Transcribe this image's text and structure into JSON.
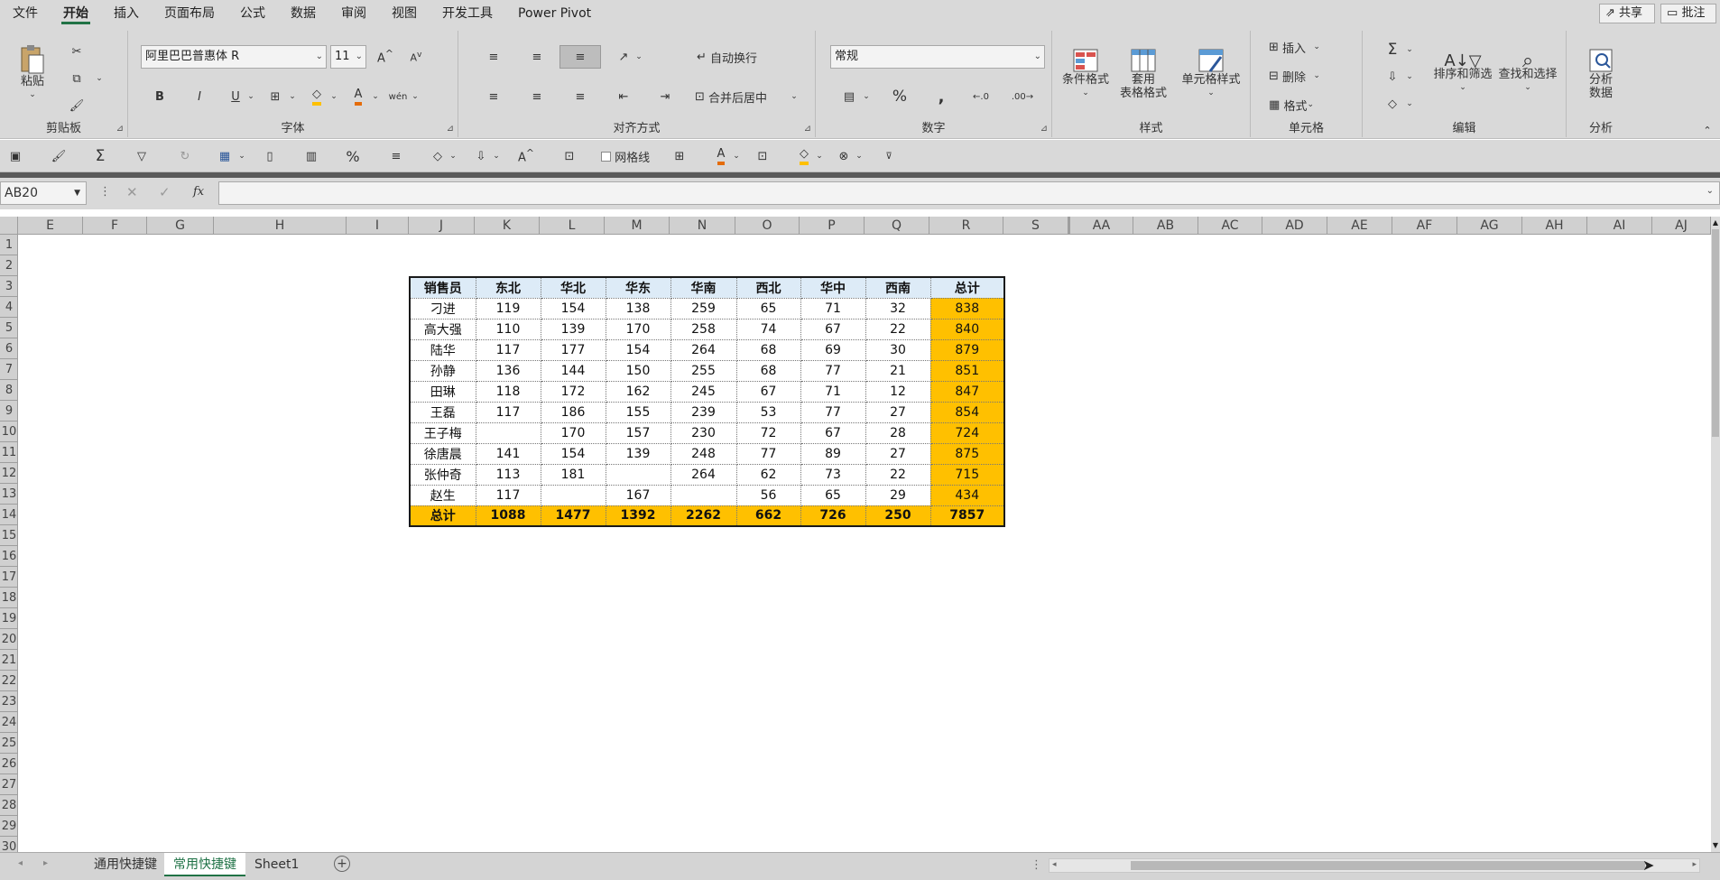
{
  "menu": {
    "items": [
      "文件",
      "开始",
      "插入",
      "页面布局",
      "公式",
      "数据",
      "审阅",
      "视图",
      "开发工具",
      "Power Pivot"
    ],
    "share": "共享",
    "comments": "批注"
  },
  "ribbon": {
    "clipboard": {
      "label": "剪贴板",
      "paste": "粘贴"
    },
    "font": {
      "label": "字体",
      "font_name": "阿里巴巴普惠体 R",
      "font_size": "11",
      "bold": "B",
      "italic": "I",
      "underline": "U"
    },
    "alignment": {
      "label": "对齐方式",
      "wrap": "自动换行",
      "merge": "合并后居中"
    },
    "number": {
      "label": "数字",
      "format": "常规"
    },
    "styles": {
      "label": "样式",
      "conditional": "条件格式",
      "table_format_1": "套用",
      "table_format_2": "表格格式",
      "cell_styles": "单元格样式"
    },
    "cells": {
      "label": "单元格",
      "insert": "插入",
      "delete": "删除",
      "format": "格式"
    },
    "editing": {
      "label": "编辑",
      "sort_filter": "排序和筛选",
      "find_select": "查找和选择"
    },
    "analysis": {
      "label": "分析",
      "analyze_1": "分析",
      "analyze_2": "数据"
    }
  },
  "qat": {
    "gridlines": "网格线"
  },
  "formula_bar": {
    "name_box": "AB20",
    "fx": "fx",
    "value": ""
  },
  "columns": [
    "E",
    "F",
    "G",
    "H",
    "I",
    "J",
    "K",
    "L",
    "M",
    "N",
    "O",
    "P",
    "Q",
    "R",
    "S",
    "AA",
    "AB",
    "AC",
    "AD",
    "AE",
    "AF",
    "AG",
    "AH",
    "AI",
    "AJ"
  ],
  "rows": [
    "1",
    "2",
    "3",
    "4",
    "5",
    "6",
    "7",
    "8",
    "9",
    "10",
    "11",
    "12",
    "13",
    "14",
    "15",
    "16",
    "17",
    "18",
    "19",
    "20",
    "21",
    "22",
    "23",
    "24",
    "25",
    "26",
    "27",
    "28",
    "29",
    "30"
  ],
  "table": {
    "header": [
      "销售员",
      "东北",
      "华北",
      "华东",
      "华南",
      "西北",
      "华中",
      "西南",
      "总计"
    ],
    "rows": [
      [
        "刁进",
        "119",
        "154",
        "138",
        "259",
        "65",
        "71",
        "32",
        "838"
      ],
      [
        "高大强",
        "110",
        "139",
        "170",
        "258",
        "74",
        "67",
        "22",
        "840"
      ],
      [
        "陆华",
        "117",
        "177",
        "154",
        "264",
        "68",
        "69",
        "30",
        "879"
      ],
      [
        "孙静",
        "136",
        "144",
        "150",
        "255",
        "68",
        "77",
        "21",
        "851"
      ],
      [
        "田琳",
        "118",
        "172",
        "162",
        "245",
        "67",
        "71",
        "12",
        "847"
      ],
      [
        "王磊",
        "117",
        "186",
        "155",
        "239",
        "53",
        "77",
        "27",
        "854"
      ],
      [
        "王子梅",
        "",
        "170",
        "157",
        "230",
        "72",
        "67",
        "28",
        "724"
      ],
      [
        "徐唐晨",
        "141",
        "154",
        "139",
        "248",
        "77",
        "89",
        "27",
        "875"
      ],
      [
        "张仲奇",
        "113",
        "181",
        "",
        "264",
        "62",
        "73",
        "22",
        "715"
      ],
      [
        "赵生",
        "117",
        "",
        "167",
        "",
        "56",
        "65",
        "29",
        "434"
      ]
    ],
    "total": [
      "总计",
      "1088",
      "1477",
      "1392",
      "2262",
      "662",
      "726",
      "250",
      "7857"
    ]
  },
  "sheet_tabs": [
    "通用快捷键",
    "常用快捷键",
    "Sheet1"
  ],
  "active_tab": "常用快捷键",
  "colors": {
    "accent": "#217346",
    "header_fill": "#ddebf7",
    "total_fill": "#ffc000"
  }
}
